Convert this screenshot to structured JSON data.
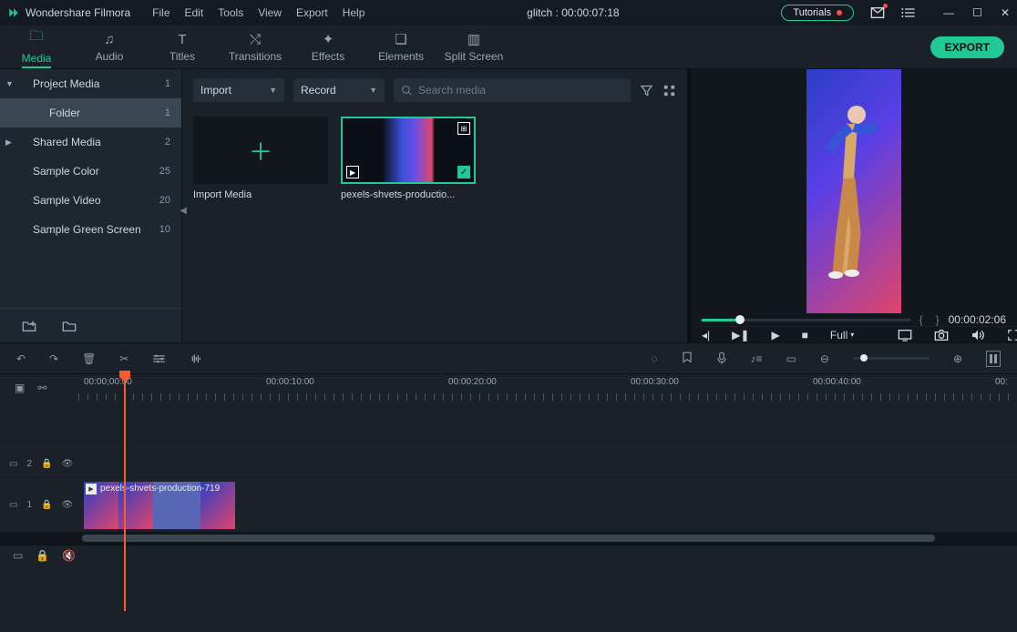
{
  "app": {
    "title": "Wondershare Filmora"
  },
  "menu": {
    "file": "File",
    "edit": "Edit",
    "tools": "Tools",
    "view": "View",
    "export": "Export",
    "help": "Help"
  },
  "project": {
    "center": "glitch : 00:00:07:18"
  },
  "tutorials": "Tutorials",
  "tabs": {
    "media": "Media",
    "audio": "Audio",
    "titles": "Titles",
    "transitions": "Transitions",
    "effects": "Effects",
    "elements": "Elements",
    "split": "Split Screen"
  },
  "export_btn": "EXPORT",
  "tree": {
    "project_media": {
      "label": "Project Media",
      "count": "1"
    },
    "folder": {
      "label": "Folder",
      "count": "1"
    },
    "shared_media": {
      "label": "Shared Media",
      "count": "2"
    },
    "sample_color": {
      "label": "Sample Color",
      "count": "25"
    },
    "sample_video": {
      "label": "Sample Video",
      "count": "20"
    },
    "sample_green": {
      "label": "Sample Green Screen",
      "count": "10"
    }
  },
  "combo": {
    "import": "Import",
    "record": "Record"
  },
  "search": {
    "placeholder": "Search media"
  },
  "media": {
    "import_label": "Import Media",
    "clip1": "pexels-shvets-productio..."
  },
  "preview": {
    "time": "00:00:02:06",
    "full": "Full"
  },
  "ruler": {
    "t0": "00:00;00:00",
    "t1": "00:00:10:00",
    "t2": "00:00:20:00",
    "t3": "00:00:30:00",
    "t4": "00:00:40:00",
    "t5": "00:"
  },
  "track": {
    "v2": "2",
    "v1": "1"
  },
  "clip": {
    "label": "pexels-shvets-production-719"
  }
}
